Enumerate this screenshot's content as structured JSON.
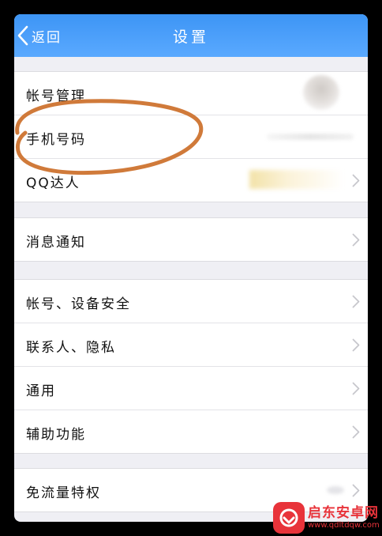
{
  "navbar": {
    "back_label": "返回",
    "title": "设置"
  },
  "groups": [
    {
      "rows": [
        {
          "label": "帐号管理",
          "name": "row-account-management"
        },
        {
          "label": "手机号码",
          "name": "row-phone-number"
        },
        {
          "label": "QQ达人",
          "name": "row-qq-master"
        }
      ]
    },
    {
      "rows": [
        {
          "label": "消息通知",
          "name": "row-notifications"
        }
      ]
    },
    {
      "rows": [
        {
          "label": "帐号、设备安全",
          "name": "row-account-device-security"
        },
        {
          "label": "联系人、隐私",
          "name": "row-contacts-privacy"
        },
        {
          "label": "通用",
          "name": "row-general"
        },
        {
          "label": "辅助功能",
          "name": "row-accessibility"
        }
      ]
    },
    {
      "rows": [
        {
          "label": "免流量特权",
          "name": "row-free-data-privilege"
        }
      ]
    }
  ],
  "watermark": {
    "name": "启东安卓网",
    "url": "www.qdltdqw.com"
  },
  "colors": {
    "navbar": "#4a9ef8",
    "annotation": "#d07a3a",
    "watermark": "#e8333a"
  }
}
